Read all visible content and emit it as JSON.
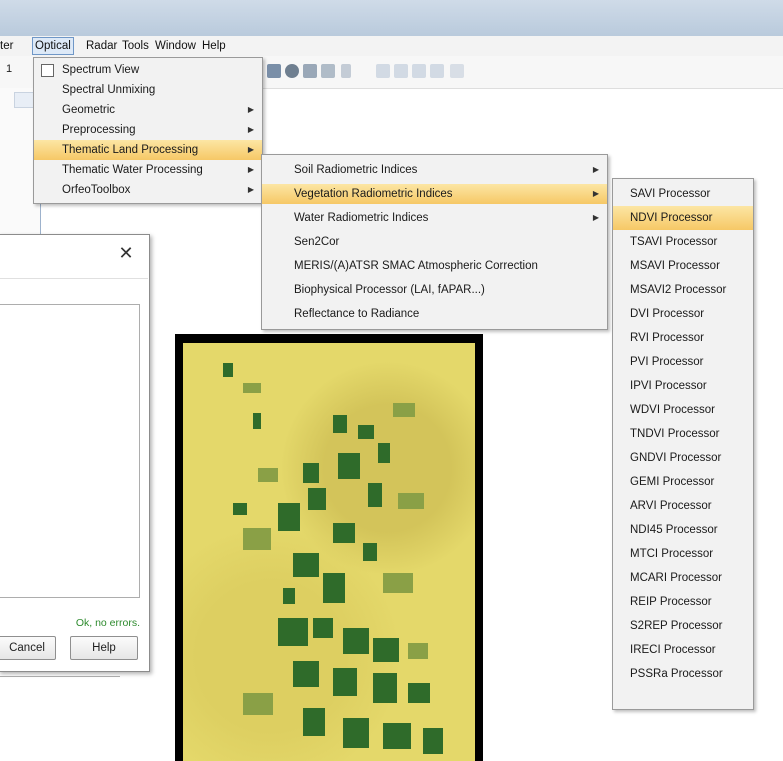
{
  "menubar": {
    "partial_left": "ter",
    "items": [
      "Optical",
      "Radar",
      "Tools",
      "Window",
      "Help"
    ]
  },
  "toolbar": {
    "left_number": "1"
  },
  "optical_menu": {
    "items": [
      {
        "label": "Spectrum View",
        "submenu": false,
        "icon": "spectrum-icon"
      },
      {
        "label": "Spectral Unmixing",
        "submenu": false
      },
      {
        "label": "Geometric",
        "submenu": true
      },
      {
        "label": "Preprocessing",
        "submenu": true
      },
      {
        "label": "Thematic Land Processing",
        "submenu": true,
        "highlighted": true
      },
      {
        "label": "Thematic Water Processing",
        "submenu": true
      },
      {
        "label": "OrfeoToolbox",
        "submenu": true
      }
    ]
  },
  "thematic_menu": {
    "items": [
      {
        "label": "Soil Radiometric Indices",
        "submenu": true
      },
      {
        "label": "Vegetation Radiometric Indices",
        "submenu": true,
        "highlighted": true
      },
      {
        "label": "Water Radiometric Indices",
        "submenu": true
      },
      {
        "label": "Sen2Cor",
        "submenu": false
      },
      {
        "label": "MERIS/(A)ATSR SMAC Atmospheric Correction",
        "submenu": false
      },
      {
        "label": "Biophysical Processor (LAI, fAPAR...)",
        "submenu": false
      },
      {
        "label": "Reflectance to Radiance",
        "submenu": false
      }
    ]
  },
  "vegetation_menu": {
    "items": [
      {
        "label": "SAVI Processor"
      },
      {
        "label": "NDVI Processor",
        "highlighted": true
      },
      {
        "label": "TSAVI Processor"
      },
      {
        "label": "MSAVI Processor"
      },
      {
        "label": "MSAVI2 Processor"
      },
      {
        "label": "DVI Processor"
      },
      {
        "label": "RVI Processor"
      },
      {
        "label": "PVI Processor"
      },
      {
        "label": "IPVI Processor"
      },
      {
        "label": "WDVI Processor"
      },
      {
        "label": "TNDVI Processor"
      },
      {
        "label": "GNDVI Processor"
      },
      {
        "label": "GEMI Processor"
      },
      {
        "label": "ARVI Processor"
      },
      {
        "label": "NDI45 Processor"
      },
      {
        "label": "MTCI Processor"
      },
      {
        "label": "MCARI Processor"
      },
      {
        "label": "REIP Processor"
      },
      {
        "label": "S2REP Processor"
      },
      {
        "label": "IRECI Processor"
      },
      {
        "label": "PSSRa Processor"
      }
    ]
  },
  "dialog": {
    "close_glyph": "✕",
    "status": "Ok, no errors.",
    "cancel_label": "Cancel",
    "help_label": "Help"
  },
  "colors": {
    "menu_highlight": "#f6c866",
    "status_ok": "#2e8b2e",
    "vegetation_dark": "#2f6b2a",
    "soil_yellow": "#e4d86a"
  }
}
